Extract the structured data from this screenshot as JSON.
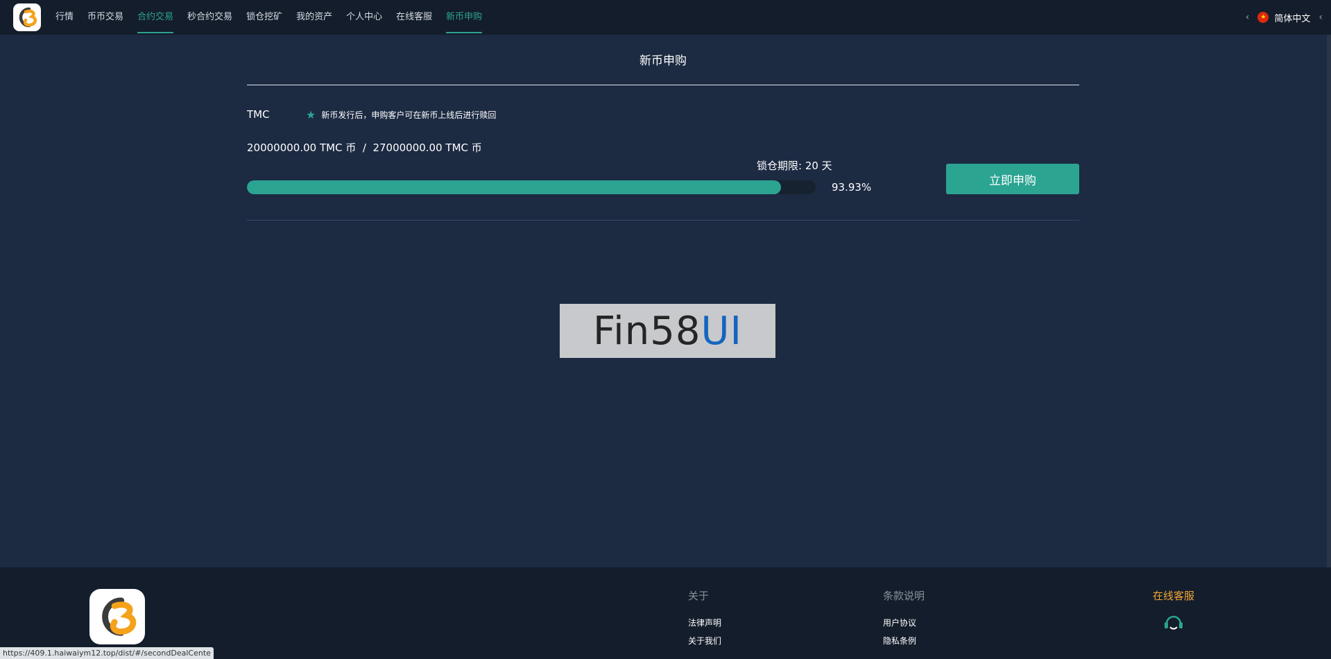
{
  "nav": {
    "items": [
      {
        "label": "行情"
      },
      {
        "label": "币币交易"
      },
      {
        "label": "合约交易"
      },
      {
        "label": "秒合约交易"
      },
      {
        "label": "锁仓挖矿"
      },
      {
        "label": "我的资产"
      },
      {
        "label": "个人中心"
      },
      {
        "label": "在线客服"
      },
      {
        "label": "新币申购"
      }
    ],
    "language": "简体中文",
    "language_flag": "china-flag-icon"
  },
  "page": {
    "title": "新币申购"
  },
  "subscription": {
    "coin": "TMC",
    "notice": "新币发行后，申购客户可在新币上线后进行赎回",
    "amount_text": "20000000.00 TMC 币  /  27000000.00 TMC 币",
    "lock_text": "锁仓期限: 20 天",
    "progress_fraction": 0.9393,
    "percent_text": "93.93%",
    "button_label": "立即申购"
  },
  "watermark": {
    "part_a": "Fin58",
    "part_b": "UI"
  },
  "footer": {
    "about": {
      "heading": "关于",
      "links": [
        "法律声明",
        "关于我们"
      ]
    },
    "terms": {
      "heading": "条款说明",
      "links": [
        "用户协议",
        "隐私条例"
      ]
    },
    "support_label": "在线客服"
  },
  "status_url": "https://409.1.haiwaiym12.top/dist/#/secondDealCente",
  "colors": {
    "accent": "#2ba492",
    "background": "#1c2a42",
    "bar_background": "#141d2b",
    "support": "#f0a733"
  }
}
